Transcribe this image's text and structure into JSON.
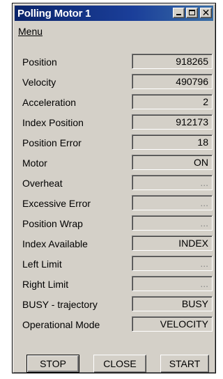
{
  "window": {
    "title": "Polling Motor 1"
  },
  "menu": {
    "label": "Menu"
  },
  "rows": [
    {
      "label": "Position",
      "value": "918265"
    },
    {
      "label": "Velocity",
      "value": "490796"
    },
    {
      "label": "Acceleration",
      "value": "2"
    },
    {
      "label": "Index Position",
      "value": "912173"
    },
    {
      "label": "Position Error",
      "value": "18"
    },
    {
      "label": "Motor",
      "value": "ON"
    },
    {
      "label": "Overheat",
      "value": "..."
    },
    {
      "label": "Excessive Error",
      "value": "..."
    },
    {
      "label": "Position Wrap",
      "value": "..."
    },
    {
      "label": "Index Available",
      "value": "INDEX"
    },
    {
      "label": "Left Limit",
      "value": "..."
    },
    {
      "label": "Right Limit",
      "value": "..."
    },
    {
      "label": "BUSY - trajectory",
      "value": "BUSY"
    },
    {
      "label": "Operational Mode",
      "value": "VELOCITY"
    }
  ],
  "buttons": {
    "stop": "STOP",
    "close": "CLOSE",
    "start": "START"
  },
  "colors": {
    "titlebar": "#0a246a",
    "face": "#d4d0c8"
  },
  "icons": {
    "minimize": "minimize-icon",
    "maximize": "maximize-icon",
    "close": "close-icon"
  }
}
